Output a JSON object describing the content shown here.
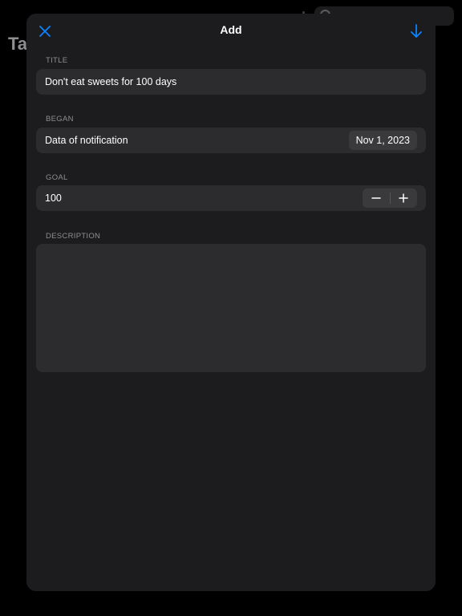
{
  "background": {
    "title_fragment": "Ta"
  },
  "nav": {
    "title": "Add",
    "close_icon": "xmark-icon",
    "save_icon": "arrow-down-icon",
    "accent_color": "#0a84ff"
  },
  "form": {
    "title": {
      "label": "TITLE",
      "value": "Don't eat sweets for 100 days"
    },
    "began": {
      "label": "BEGAN",
      "text": "Data of notification",
      "date": "Nov 1, 2023"
    },
    "goal": {
      "label": "GOAL",
      "value": "100",
      "decrement_icon": "minus-icon",
      "increment_icon": "plus-icon"
    },
    "description": {
      "label": "DESCRIPTION",
      "value": ""
    }
  }
}
